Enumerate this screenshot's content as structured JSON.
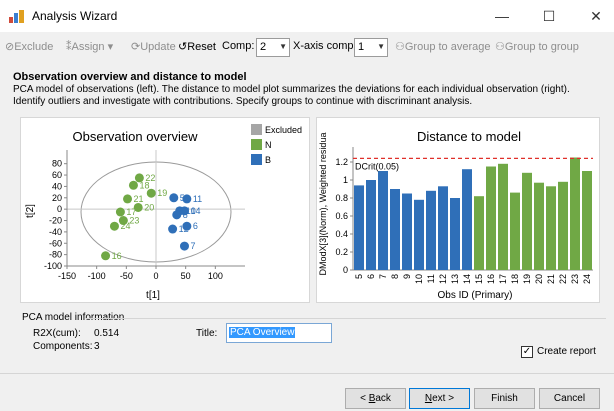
{
  "window": {
    "title": "Analysis Wizard",
    "controls": {
      "minimize": "—",
      "maximize": "☐",
      "close": "✕"
    }
  },
  "toolbar": {
    "exclude": "Exclude",
    "assign": "Assign",
    "update": "Update",
    "reset": "Reset",
    "comp_label": "Comp:",
    "comp_value": "2",
    "xaxis_label": "X-axis comp:",
    "xaxis_value": "1",
    "group_average": "Group to average",
    "group_group": "Group to group"
  },
  "heading": "Observation overview and distance to model",
  "description": "PCA model of observations (left). The distance to model plot summarizes the deviations for each individual observation (right). Identify outliers and investigate with contributions. Specify groups to continue with discriminant analysis.",
  "chart_data": [
    {
      "type": "scatter",
      "title": "Observation overview",
      "xlabel": "t[1]",
      "ylabel": "t[2]",
      "xlim": [
        -150,
        150
      ],
      "ylim": [
        -100,
        90
      ],
      "xticks": [
        "-150",
        "-100",
        "-50",
        "0",
        "50",
        "100"
      ],
      "yticks": [
        "80",
        "60",
        "40",
        "20",
        "0",
        "-20",
        "-40",
        "-60",
        "-80",
        "-100"
      ],
      "legend": [
        "Excluded",
        "N",
        "B"
      ],
      "legend_colors": [
        "#a6a6a6",
        "#70a845",
        "#2f6fb8"
      ],
      "points": [
        {
          "label": "22",
          "x": -28,
          "y": 55,
          "group": "N"
        },
        {
          "label": "18",
          "x": -38,
          "y": 42,
          "group": "N"
        },
        {
          "label": "19",
          "x": -8,
          "y": 28,
          "group": "N"
        },
        {
          "label": "21",
          "x": -48,
          "y": 18,
          "group": "N"
        },
        {
          "label": "20",
          "x": -30,
          "y": 3,
          "group": "N"
        },
        {
          "label": "17",
          "x": -60,
          "y": -5,
          "group": "N"
        },
        {
          "label": "23",
          "x": -55,
          "y": -20,
          "group": "N"
        },
        {
          "label": "24",
          "x": -70,
          "y": -30,
          "group": "N"
        },
        {
          "label": "16",
          "x": -85,
          "y": -82,
          "group": "N"
        },
        {
          "label": "5",
          "x": 30,
          "y": 20,
          "group": "B"
        },
        {
          "label": "11",
          "x": 52,
          "y": 18,
          "group": "B"
        },
        {
          "label": "10",
          "x": 40,
          "y": -3,
          "group": "B"
        },
        {
          "label": "14",
          "x": 48,
          "y": -3,
          "group": "B"
        },
        {
          "label": "8",
          "x": 35,
          "y": -10,
          "group": "B"
        },
        {
          "label": "12",
          "x": 28,
          "y": -35,
          "group": "B"
        },
        {
          "label": "6",
          "x": 52,
          "y": -30,
          "group": "B"
        },
        {
          "label": "7",
          "x": 48,
          "y": -65,
          "group": "B"
        }
      ]
    },
    {
      "type": "bar",
      "title": "Distance to model",
      "xlabel": "Obs ID (Primary)",
      "ylabel": "DModX[3](Norm), Weighted residua",
      "ylim": [
        0,
        1.3
      ],
      "yticks": [
        "0",
        "0.2",
        "0.4",
        "0.6",
        "0.8",
        "1",
        "1.2"
      ],
      "threshold": {
        "label": "DCrit(0.05)",
        "value": 1.24
      },
      "categories": [
        "5",
        "6",
        "7",
        "8",
        "9",
        "10",
        "11",
        "12",
        "13",
        "14",
        "15",
        "16",
        "17",
        "18",
        "19",
        "20",
        "21",
        "22",
        "23",
        "24"
      ],
      "values": [
        0.94,
        1.0,
        1.1,
        0.9,
        0.85,
        0.78,
        0.88,
        0.93,
        0.8,
        1.12,
        0.82,
        1.15,
        1.18,
        0.86,
        1.08,
        0.97,
        0.93,
        0.98,
        1.25,
        1.1
      ],
      "groups": [
        "B",
        "B",
        "B",
        "B",
        "B",
        "B",
        "B",
        "B",
        "B",
        "B",
        "N",
        "N",
        "N",
        "N",
        "N",
        "N",
        "N",
        "N",
        "N",
        "N"
      ],
      "colors": {
        "B": "#2f6fb8",
        "N": "#70a845",
        "threshold": "#e0302a"
      }
    }
  ],
  "model_info": {
    "section_label": "PCA model information",
    "r2x_label": "R2X(cum):",
    "r2x_value": "0.514",
    "components_label": "Components:",
    "components_value": "3",
    "title_label": "Title:",
    "title_value": "PCA Overview",
    "create_report_label": "Create report",
    "create_report_checked": "✓"
  },
  "buttons": {
    "back_lt": "< ",
    "back_key": "B",
    "back_rest": "ack",
    "next_key": "N",
    "next_rest": "ext >",
    "finish": "Finish",
    "cancel": "Cancel"
  }
}
